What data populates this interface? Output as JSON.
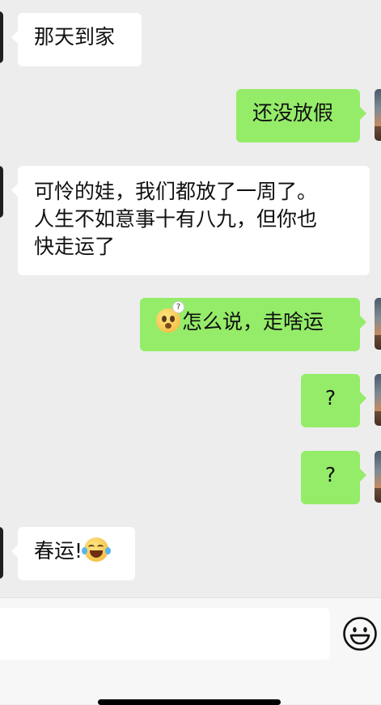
{
  "messages": [
    {
      "side": "left",
      "text": "那天到家"
    },
    {
      "side": "right",
      "text": "还没放假"
    },
    {
      "side": "left",
      "lines": [
        "可怜的娃，我们都放了一周了。",
        "人生不如意事十有八九，但你也",
        "快走运了"
      ]
    },
    {
      "side": "right",
      "emoji": "thinking-face-with-question-mark-icon",
      "text": "怎么说，走啥运"
    },
    {
      "side": "right",
      "text": "?"
    },
    {
      "side": "right",
      "text": "?"
    },
    {
      "side": "left",
      "text": "春运!",
      "emoji": "tears-of-joy-face-icon"
    }
  ],
  "input_bar": {
    "text_value": "",
    "emoji_button_icon": "smiley-face-icon"
  },
  "colors": {
    "background": "#ededed",
    "incoming_bubble": "#ffffff",
    "outgoing_bubble": "#95ec69",
    "input_bar": "#f7f7f7"
  }
}
